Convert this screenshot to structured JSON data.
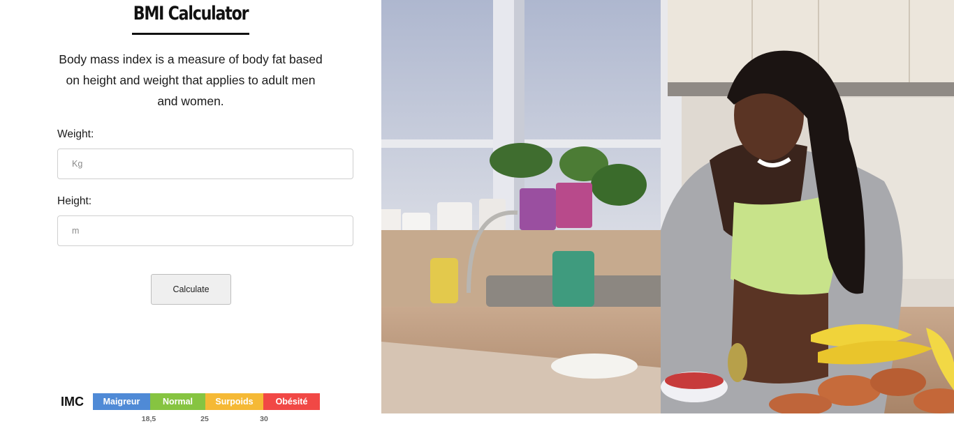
{
  "header": {
    "title": "BMI Calculator"
  },
  "intro": {
    "text": "Body mass index is a measure of body fat based on height and weight that applies to adult men and women."
  },
  "form": {
    "weight": {
      "label": "Weight:",
      "placeholder": "Kg"
    },
    "height": {
      "label": "Height:",
      "placeholder": "m"
    },
    "submit_label": "Calculate"
  },
  "scale": {
    "label": "IMC",
    "segments": [
      {
        "label": "Maigreur",
        "color": "#4f8ad6"
      },
      {
        "label": "Normal",
        "color": "#86c441"
      },
      {
        "label": "Surpoids",
        "color": "#f5b935"
      },
      {
        "label": "Obésité",
        "color": "#f14845"
      }
    ],
    "ticks": [
      "18,5",
      "25",
      "30"
    ]
  },
  "photo": {
    "alt": "Woman slicing fruit in a kitchen"
  }
}
